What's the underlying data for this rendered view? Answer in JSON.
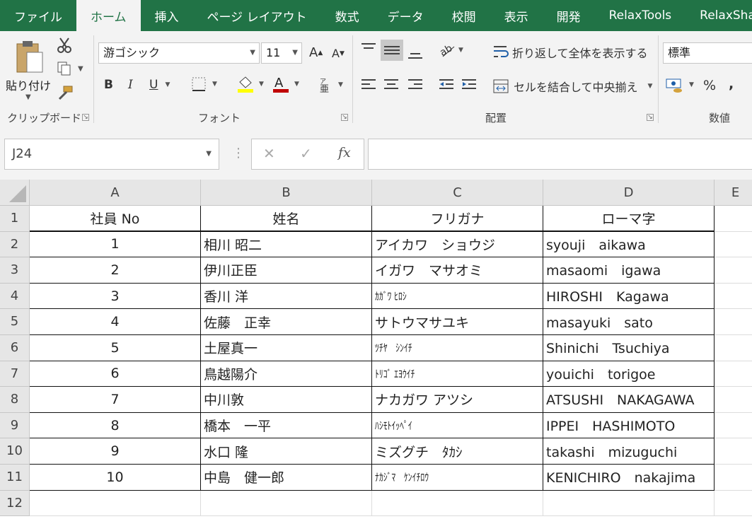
{
  "tabs": [
    "ファイル",
    "ホーム",
    "挿入",
    "ページ レイアウト",
    "数式",
    "データ",
    "校閲",
    "表示",
    "開発",
    "RelaxTools",
    "RelaxShapes"
  ],
  "active_tab_index": 1,
  "ribbon": {
    "clipboard": {
      "paste_label": "貼り付け",
      "group_label": "クリップボード"
    },
    "font": {
      "font_name": "游ゴシック",
      "font_size": "11",
      "group_label": "フォント"
    },
    "alignment": {
      "wrap_text": "折り返して全体を表示する",
      "merge_center": "セルを結合して中央揃え",
      "group_label": "配置"
    },
    "number": {
      "format": "標準",
      "group_label": "数値"
    }
  },
  "formula_bar": {
    "name_box": "J24",
    "formula": ""
  },
  "columns": [
    "A",
    "B",
    "C",
    "D",
    "E"
  ],
  "rows": [
    "1",
    "2",
    "3",
    "4",
    "5",
    "6",
    "7",
    "8",
    "9",
    "10",
    "11",
    "12"
  ],
  "table": {
    "headers": [
      "社員 No",
      "姓名",
      "フリガナ",
      "ローマ字"
    ],
    "records": [
      {
        "no": "1",
        "name": "相川 昭二",
        "kana": "アイカワ　ショウジ",
        "roman": "syouji　aikawa",
        "halfwidth": false
      },
      {
        "no": "2",
        "name": "伊川正臣",
        "kana": "イガワ　マサオミ",
        "roman": "masaomi　igawa",
        "halfwidth": false
      },
      {
        "no": "3",
        "name": "香川 洋",
        "kana": "ｶｶﾞﾜ ﾋﾛｼ",
        "roman": "HIROSHI　Kagawa",
        "halfwidth": true
      },
      {
        "no": "4",
        "name": "佐藤　正幸",
        "kana": "サトウマサユキ",
        "roman": "masayuki　sato",
        "halfwidth": false
      },
      {
        "no": "5",
        "name": "土屋真一",
        "kana": "ﾂﾁﾔ　ｼﾝｲﾁ",
        "roman": "Shinichi　Tsuchiya",
        "halfwidth": true
      },
      {
        "no": "6",
        "name": "鳥越陽介",
        "kana": "ﾄﾘｺﾞ ｴﾖｳｲﾁ",
        "roman": "youichi　torigoe",
        "halfwidth": true
      },
      {
        "no": "7",
        "name": "中川敦",
        "kana": "ナカガワ アツシ",
        "roman": "ATSUSHI　NAKAGAWA",
        "halfwidth": false
      },
      {
        "no": "8",
        "name": "橋本　一平",
        "kana": "ﾊｼﾓﾄｲｯﾍﾟｲ",
        "roman": "IPPEI　HASHIMOTO",
        "halfwidth": true
      },
      {
        "no": "9",
        "name": "水口 隆",
        "kana": "ミズグチ　ﾀｶｼ",
        "roman": "takashi　mizuguchi",
        "halfwidth": false
      },
      {
        "no": "10",
        "name": "中島　健一郎",
        "kana": "ﾅｶｼﾞﾏ　ｹﾝｲﾁﾛｳ",
        "roman": "KENICHIRO　nakajima",
        "halfwidth": true
      }
    ]
  },
  "colors": {
    "excel_green": "#217346",
    "ribbon_bg": "#f3f3f3",
    "header_bg": "#e6e6e6"
  }
}
